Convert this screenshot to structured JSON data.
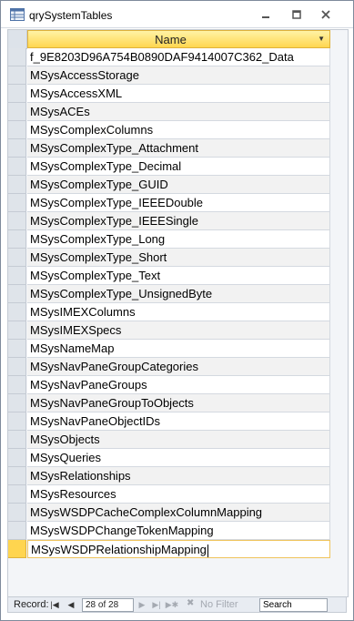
{
  "window": {
    "title": "qrySystemTables",
    "icon": "query-icon",
    "controls": [
      "minimize-icon",
      "maximize-icon",
      "close-icon"
    ]
  },
  "table": {
    "column_header": "Name",
    "rows": [
      "f_9E8203D96A754B0890DAF9414007C362_Data",
      "MSysAccessStorage",
      "MSysAccessXML",
      "MSysACEs",
      "MSysComplexColumns",
      "MSysComplexType_Attachment",
      "MSysComplexType_Decimal",
      "MSysComplexType_GUID",
      "MSysComplexType_IEEEDouble",
      "MSysComplexType_IEEESingle",
      "MSysComplexType_Long",
      "MSysComplexType_Short",
      "MSysComplexType_Text",
      "MSysComplexType_UnsignedByte",
      "MSysIMEXColumns",
      "MSysIMEXSpecs",
      "MSysNameMap",
      "MSysNavPaneGroupCategories",
      "MSysNavPaneGroups",
      "MSysNavPaneGroupToObjects",
      "MSysNavPaneObjectIDs",
      "MSysObjects",
      "MSysQueries",
      "MSysRelationships",
      "MSysResources",
      "MSysWSDPCacheComplexColumnMapping",
      "MSysWSDPChangeTokenMapping",
      "MSysWSDPRelationshipMapping"
    ],
    "active_row": 28
  },
  "navigation": {
    "record_label": "Record:",
    "record_position": "28 of 28",
    "filter_label": "No Filter",
    "search_placeholder": "Search"
  }
}
